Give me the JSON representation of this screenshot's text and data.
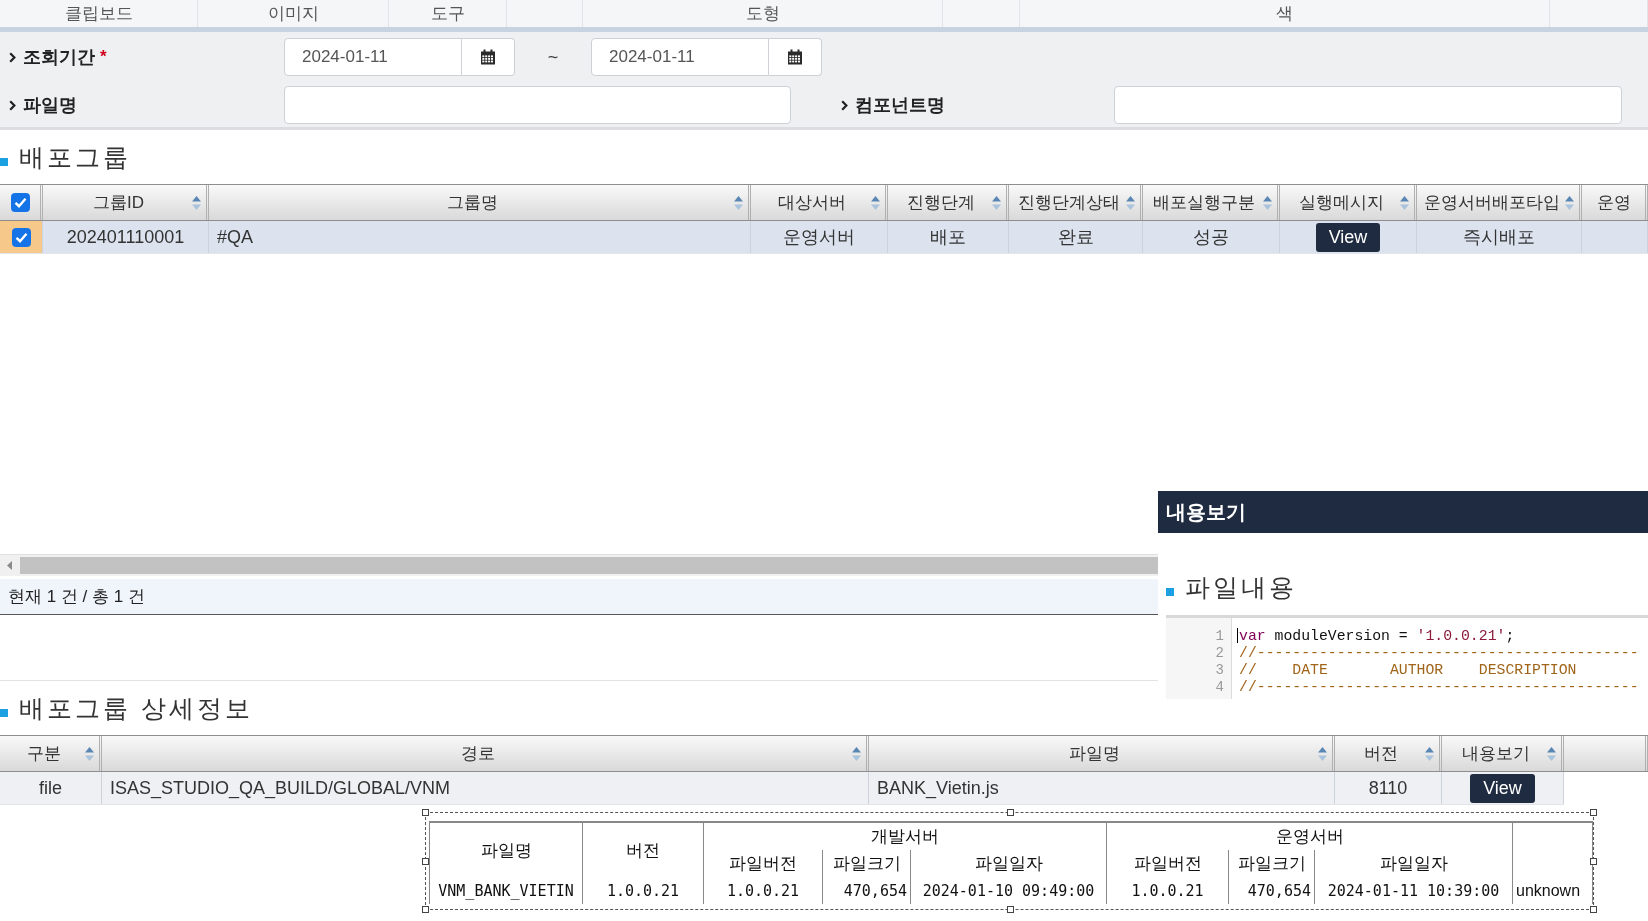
{
  "ribbon": {
    "groups": [
      "클립보드",
      "이미지",
      "도구",
      "도형",
      "색"
    ]
  },
  "search": {
    "period": {
      "label": "조회기간",
      "required_mark": "*",
      "from": "2024-01-11",
      "separator": "~",
      "to": "2024-01-11"
    },
    "file_name": {
      "label": "파일명"
    },
    "component_name": {
      "label": "컴포넌트명"
    }
  },
  "deploy_group": {
    "title": "배포그룹",
    "select_all": {
      "checked": true
    },
    "columns": [
      {
        "label": "그룹ID",
        "sortable": true
      },
      {
        "label": "그룹명",
        "sortable": true
      },
      {
        "label": "대상서버",
        "sortable": true
      },
      {
        "label": "진행단계",
        "sortable": true
      },
      {
        "label": "진행단계상태",
        "sortable": true
      },
      {
        "label": "배포실행구분",
        "sortable": true
      },
      {
        "label": "실행메시지",
        "sortable": true
      },
      {
        "label": "운영서버배포타입",
        "sortable": true
      },
      {
        "label": "운영",
        "sortable": false
      }
    ],
    "rows": [
      {
        "selected": true,
        "checked": true,
        "cells": [
          {
            "kind": "text",
            "text": "202401110001"
          },
          {
            "kind": "text",
            "text": "#QA"
          },
          {
            "kind": "text",
            "text": "운영서버"
          },
          {
            "kind": "text",
            "text": "배포"
          },
          {
            "kind": "text",
            "text": "완료"
          },
          {
            "kind": "text",
            "text": "성공"
          },
          {
            "kind": "button",
            "text": "View"
          },
          {
            "kind": "text",
            "text": "즉시배포"
          }
        ]
      }
    ],
    "status": "현재 1 건 / 총 1 건"
  },
  "content_viewer": {
    "title": "내용보기",
    "section_title": "파일내용",
    "code_lines": [
      {
        "number": "1",
        "tokens": [
          {
            "kind": "keyword",
            "text": "var"
          },
          {
            "kind": "plain",
            "text": " moduleVersion = "
          },
          {
            "kind": "string",
            "text": "'1.0.0.21'"
          },
          {
            "kind": "plain",
            "text": ";"
          }
        ]
      },
      {
        "number": "2",
        "tokens": [
          {
            "kind": "comment",
            "text": "//-------------------------------------------"
          }
        ]
      },
      {
        "number": "3",
        "tokens": [
          {
            "kind": "comment",
            "text": "//    DATE       AUTHOR    DESCRIPTION"
          }
        ]
      },
      {
        "number": "4",
        "tokens": [
          {
            "kind": "comment",
            "text": "//-------------------------------------------"
          }
        ]
      }
    ]
  },
  "deploy_detail": {
    "title": "배포그룹 상세정보",
    "columns": [
      {
        "label": "구분",
        "sortable": true
      },
      {
        "label": "경로",
        "sortable": true
      },
      {
        "label": "파일명",
        "sortable": true
      },
      {
        "label": "버전",
        "sortable": true
      },
      {
        "label": "내용보기",
        "sortable": true
      }
    ],
    "rows": [
      {
        "selected": false,
        "cells": [
          {
            "kind": "text",
            "text": "file"
          },
          {
            "kind": "text",
            "text": "ISAS_STUDIO_QA_BUILD/GLOBAL/VNM"
          },
          {
            "kind": "text",
            "text": "BANK_Vietin.js"
          },
          {
            "kind": "text",
            "text": "8110"
          },
          {
            "kind": "button",
            "text": "View"
          }
        ]
      }
    ]
  },
  "comparison_table": {
    "header_rows": [
      [
        {
          "text": "파일명",
          "rowspan": 2
        },
        {
          "text": "버전",
          "rowspan": 2
        },
        {
          "text": "개발서버",
          "colspan": 3
        },
        {
          "text": "운영서버",
          "colspan": 3
        }
      ],
      [
        {
          "text": "파일버전"
        },
        {
          "text": "파일크기"
        },
        {
          "text": "파일일자"
        },
        {
          "text": "파일버전"
        },
        {
          "text": "파일크기"
        },
        {
          "text": "파일일자"
        }
      ]
    ],
    "rows": [
      [
        "VNM_BANK_VIETIN",
        "1.0.0.21",
        "1.0.0.21",
        "470,654",
        "2024-01-10 09:49:00",
        "1.0.0.21",
        "470,654",
        "2024-01-11 10:39:00",
        "unknown"
      ]
    ]
  }
}
